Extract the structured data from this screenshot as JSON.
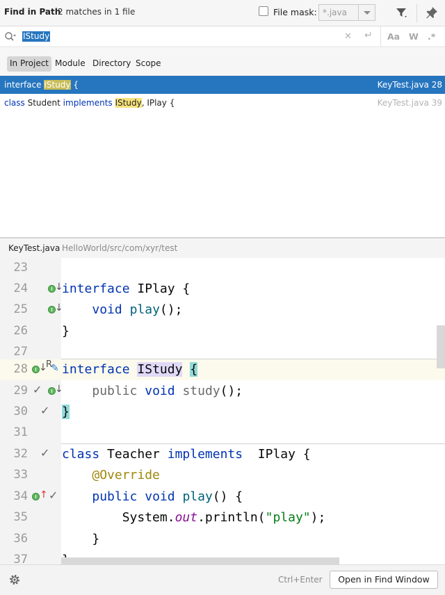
{
  "header": {
    "title": "Find in Path",
    "match_count": "2 matches in 1 file",
    "file_mask_label": "File mask:",
    "file_mask_value": "*.java"
  },
  "search": {
    "query": "IStudy",
    "options": [
      "Aa",
      "W",
      ".*"
    ]
  },
  "scopes": {
    "items": [
      "In Project",
      "Module",
      "Directory",
      "Scope"
    ],
    "active": "In Project"
  },
  "results": [
    {
      "prefix": "interface ",
      "match": "IStudy",
      "suffix": " {",
      "file": "KeyTest.java 28",
      "selected": true
    },
    {
      "kw1": "class",
      "mid": " Student ",
      "kw2": "implements",
      "match": "IStudy",
      "suffix": ", IPlay {",
      "file": "KeyTest.java 39",
      "selected": false
    }
  ],
  "preview": {
    "file": "KeyTest.java",
    "path": "HelloWorld/src/com/xyr/test"
  },
  "editor": {
    "line_numbers": [
      "23",
      "24",
      "25",
      "26",
      "27",
      "28",
      "29",
      "30",
      "31",
      "32",
      "33",
      "34",
      "35",
      "36",
      "37"
    ],
    "tokens": {
      "interface": "interface",
      "iplay": "IPlay",
      "brace_open": " {",
      "void": "void",
      "play_call": "play",
      "parens_semi": "();",
      "brace_close": "}",
      "istudy": "IStudy",
      "public": "public",
      "study": "study",
      "class": "class",
      "teacher": " Teacher ",
      "implements": "implements",
      "iplay_sp": "  IPlay {",
      "override": "@Override",
      "play_sig": "play",
      "sig_rest": "() {",
      "system": "System.",
      "out": "out",
      "println": ".println(",
      "str_play": "\"play\"",
      "close_paren": ");"
    }
  },
  "footer": {
    "shortcut": "Ctrl+Enter",
    "open_button": "Open in Find Window"
  },
  "colors": {
    "selection": "#2675bf",
    "keyword": "#0033b3",
    "method": "#00627a",
    "string": "#067d17",
    "annotation": "#9e880d",
    "match_highlight": "#f5e27a"
  }
}
